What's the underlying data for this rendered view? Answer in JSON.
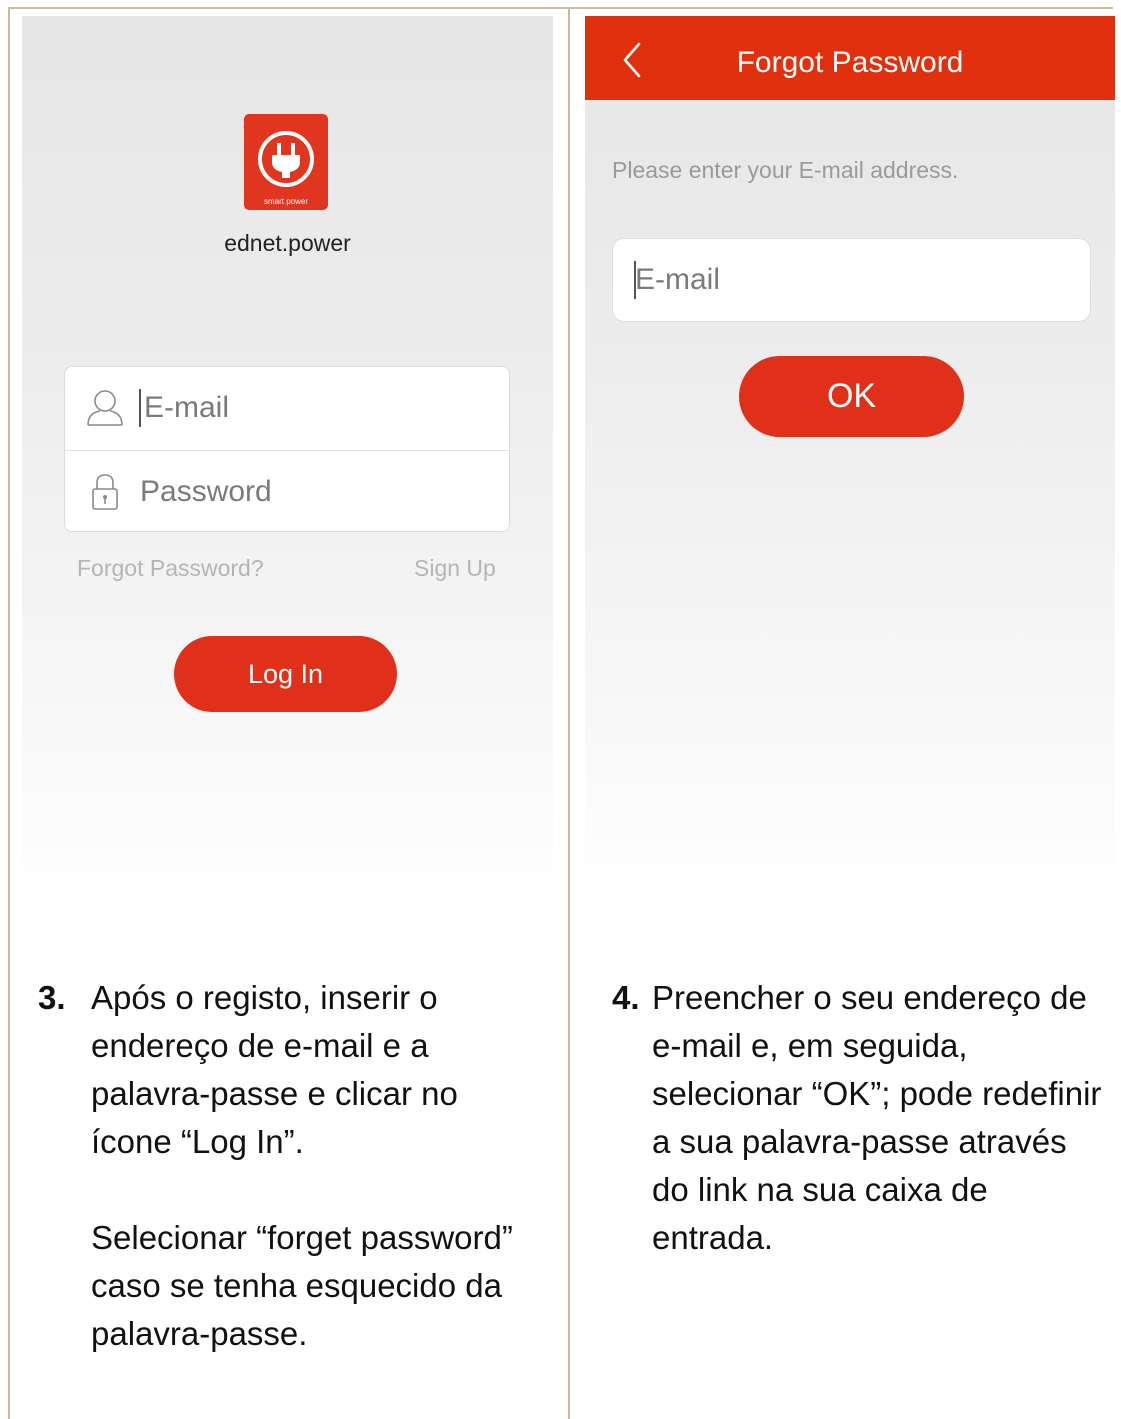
{
  "left_screen": {
    "logo_caption": "smart power",
    "app_name": "ednet.power",
    "email_placeholder": "E-mail",
    "password_placeholder": "Password",
    "forgot_link": "Forgot Password?",
    "signup_link": "Sign Up",
    "login_button": "Log In"
  },
  "right_screen": {
    "title": "Forgot Password",
    "instruction": "Please enter your E-mail address.",
    "email_placeholder": "E-mail",
    "ok_button": "OK"
  },
  "captions": {
    "step3_number": "3.",
    "step3_text": "Após o registo, inserir o endereço de e-mail e a palavra-passe e clicar no ícone “Log In”.",
    "step3_text2": "Selecionar “forget password” caso se tenha esquecido da palavra-passe.",
    "step4_number": "4.",
    "step4_text": "Preencher o seu endereço de e-mail e, em seguida, selecionar “OK”; pode redefinir a sua palavra-passe através do link na sua caixa de entrada."
  },
  "colors": {
    "accent_red": "#e0301a",
    "frame": "#c9bc96"
  }
}
